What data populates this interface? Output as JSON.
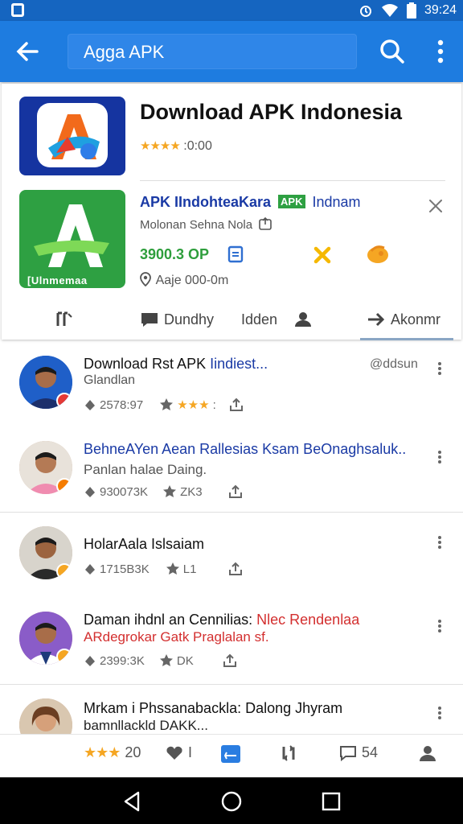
{
  "status_bar": {
    "time": "39:24"
  },
  "app_bar": {
    "search_text": "Agga APK"
  },
  "app_card": {
    "title": "Download APK Indonesia",
    "rating_stars": "★★★★",
    "rating_text": ":0:00",
    "sub_title": "APK IIndohteaKara",
    "sub_badge": "APK",
    "sub_title_tail": "Indnam",
    "sub_desc": "Molonan Sehna Nola",
    "sub_price": "3900.3 OP",
    "sub_location": "Aaje 000-0m",
    "icon_brand": "[Ulnmemaa"
  },
  "tabs": [
    {
      "label": ""
    },
    {
      "label": "Dundhy"
    },
    {
      "label": "Idden"
    },
    {
      "label": "Akonmr"
    }
  ],
  "list": [
    {
      "title": "Download Rst APK ",
      "title_blue": "Iindiest...",
      "handle": "@ddsun",
      "subtitle": "Glandlan",
      "stat1": "2578:97",
      "stat2_stars": "★★★",
      "stat2": ":",
      "title_color": "#111"
    },
    {
      "title": "BehneAYen Aean Rallesias Ksam BeOnaghsaluk..",
      "subtitle": "Panlan halae Daing.",
      "stat1": "930073K",
      "stat2": "ZK3"
    },
    {
      "title": "HolarAala Islsaiam",
      "subtitle": "",
      "stat1": "1715B3K",
      "stat2": "L1"
    },
    {
      "title": "Daman ihdnl an Cennilias: ",
      "title_red": "Nlec Rendenlaa",
      "subtitle_red": "ARdegrokar Gatk Praglalan sf.",
      "stat1": "2399:3K",
      "stat2": "DK"
    },
    {
      "title": "Mrkam i Phssanabackla: Dalong Jhyram",
      "subtitle": "bamnllackld DAKK..."
    }
  ],
  "bottom_actions": {
    "stars": "★★★",
    "rating": "20",
    "likes": "I",
    "comments": "54"
  },
  "colors": {
    "primary": "#1e7ce0",
    "status": "#1565c0",
    "accent_green": "#2ea042",
    "star": "#f5a623",
    "red": "#d32f2f"
  }
}
